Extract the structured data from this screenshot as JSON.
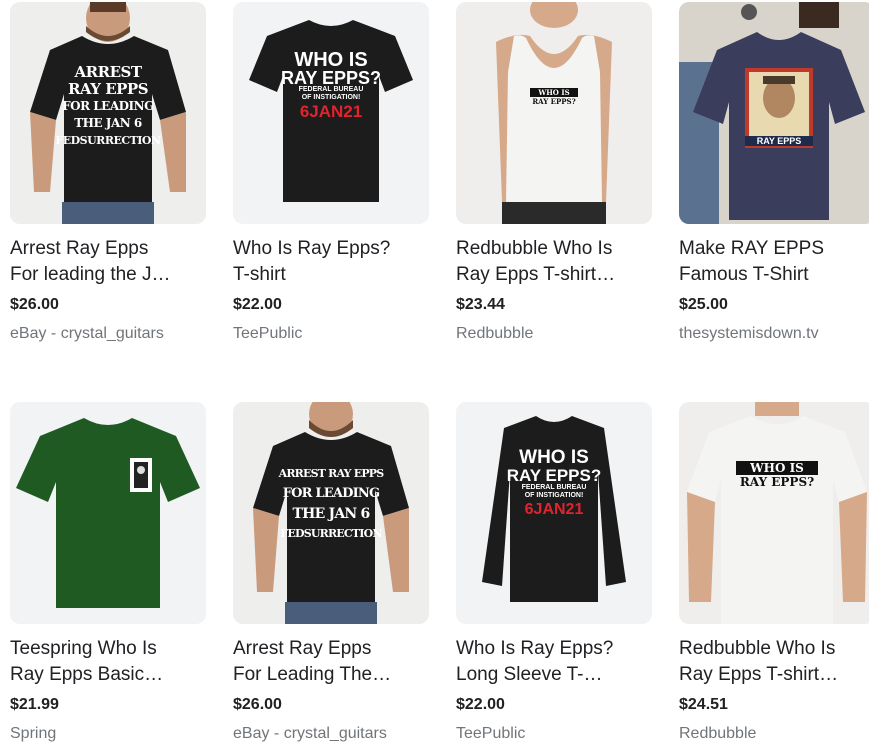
{
  "products": [
    {
      "title_line1": "Arrest Ray Epps",
      "title_line2": "For leading the J…",
      "price": "$26.00",
      "merchant": "eBay - crystal_guitars",
      "print_lines": [
        "ARREST",
        "RAY EPPS",
        "FOR LEADING",
        "THE JAN 6",
        "FEDSURRECTION"
      ]
    },
    {
      "title_line1": "Who Is Ray Epps?",
      "title_line2": "T-shirt",
      "price": "$22.00",
      "merchant": "TeePublic",
      "print_lines": [
        "WHO IS",
        "RAY EPPS?",
        "FEDERAL BUREAU",
        "OF INSTIGATION!",
        "6JAN21"
      ]
    },
    {
      "title_line1": "Redbubble Who Is",
      "title_line2": "Ray Epps T-shirt…",
      "price": "$23.44",
      "merchant": "Redbubble",
      "print_lines": [
        "WHO IS",
        "RAY EPPS?"
      ]
    },
    {
      "title_line1": "Make RAY EPPS",
      "title_line2": "Famous T-Shirt",
      "price": "$25.00",
      "merchant": "thesystemisdown.tv",
      "print_lines": [
        "RAY EPPS"
      ]
    },
    {
      "title_line1": "Teespring Who Is",
      "title_line2": "Ray Epps Basic…",
      "price": "$21.99",
      "merchant": "Spring",
      "print_lines": []
    },
    {
      "title_line1": "Arrest Ray Epps",
      "title_line2": "For Leading The…",
      "price": "$26.00",
      "merchant": "eBay - crystal_guitars",
      "print_lines": [
        "ARREST RAY EPPS",
        "FOR LEADING",
        "THE JAN 6",
        "FEDSURRECTION"
      ]
    },
    {
      "title_line1": "Who Is Ray Epps?",
      "title_line2": "Long Sleeve T-…",
      "price": "$22.00",
      "merchant": "TeePublic",
      "print_lines": [
        "WHO IS",
        "RAY EPPS?",
        "FEDERAL BUREAU",
        "OF INSTIGATION!",
        "6JAN21"
      ]
    },
    {
      "title_line1": "Redbubble Who Is",
      "title_line2": "Ray Epps T-shirt…",
      "price": "$24.51",
      "merchant": "Redbubble",
      "print_lines": [
        "WHO IS",
        "RAY EPPS?"
      ]
    }
  ],
  "colors": {
    "black_shirt": "#1c1c1c",
    "white_shirt": "#f4f4f2",
    "navy_shirt": "#3a3d5c",
    "green_shirt": "#1f5a22",
    "print_red": "#e0242e",
    "thumb_bg": "#f1f3f4"
  }
}
